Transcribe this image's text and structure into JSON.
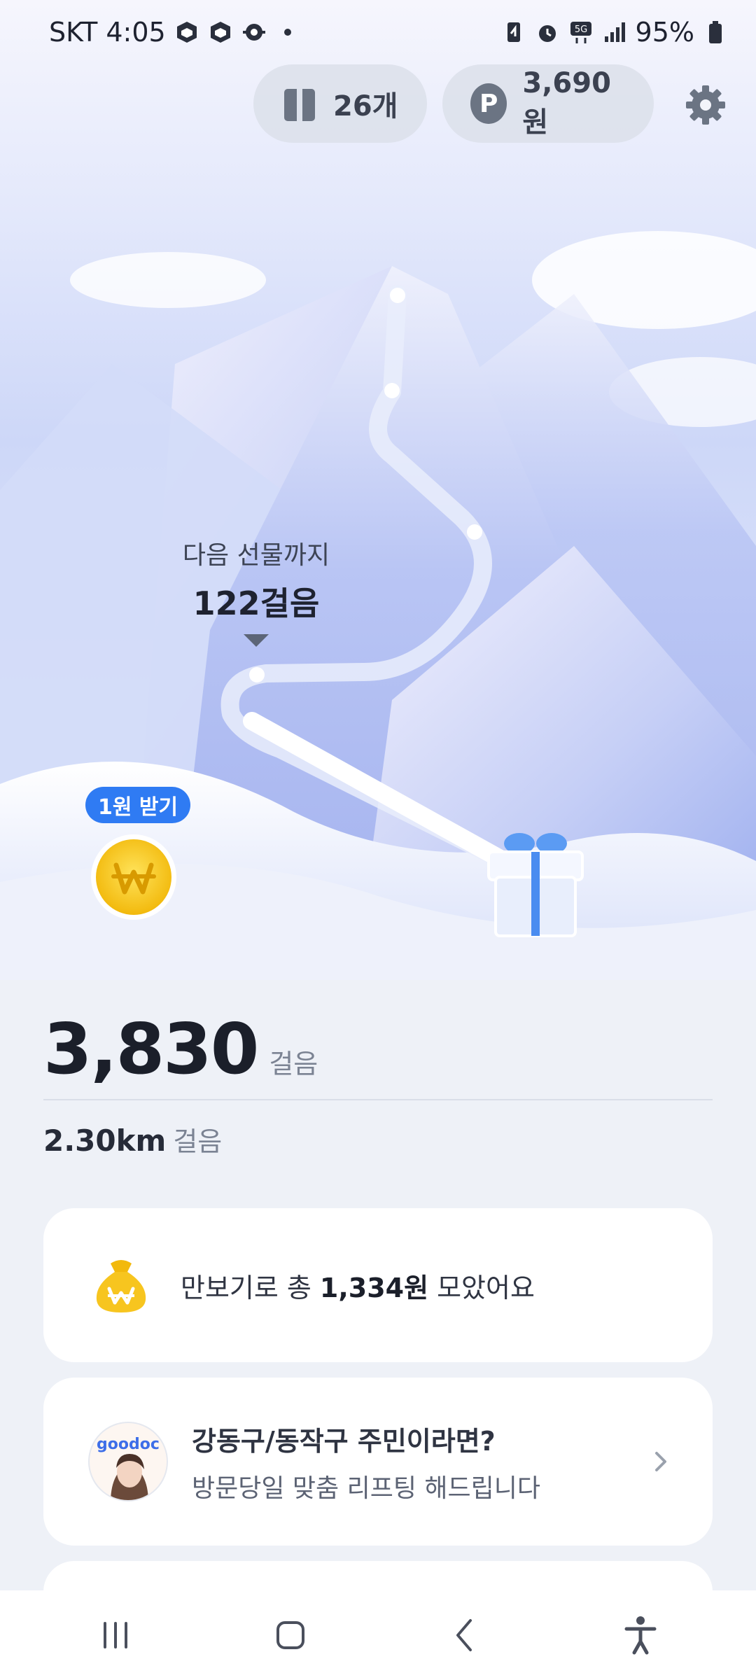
{
  "status_bar": {
    "carrier_time": "SKT 4:05",
    "battery": "95%",
    "icons": [
      "cube-icon",
      "cube-icon",
      "bug-icon",
      "dot-icon",
      "battery-saver-icon",
      "alarm-icon",
      "5g-icon",
      "signal-icon",
      "battery-icon"
    ]
  },
  "top": {
    "gift_count": "26개",
    "points": "3,690원",
    "point_symbol": "P"
  },
  "hero": {
    "next_gift_label": "다음 선물까지",
    "next_gift_steps": "122걸음",
    "coin_badge": "1원 받기",
    "coin_symbol": "₩"
  },
  "steps": {
    "value": "3,830",
    "unit": "걸음"
  },
  "distance": {
    "value": "2.30km",
    "unit": "걸음"
  },
  "total_card": {
    "prefix": "만보기로 총",
    "amount": "1,334원",
    "suffix": "모았어요"
  },
  "ad_card": {
    "brand": "goodoc",
    "title": "강동구/동작구 주민이라면?",
    "subtitle": "방문당일 맞춤 리프팅 해드립니다"
  },
  "colors": {
    "accent": "#2f7bf3",
    "coin": "#f7c51f",
    "chip": "#dde2ec"
  }
}
